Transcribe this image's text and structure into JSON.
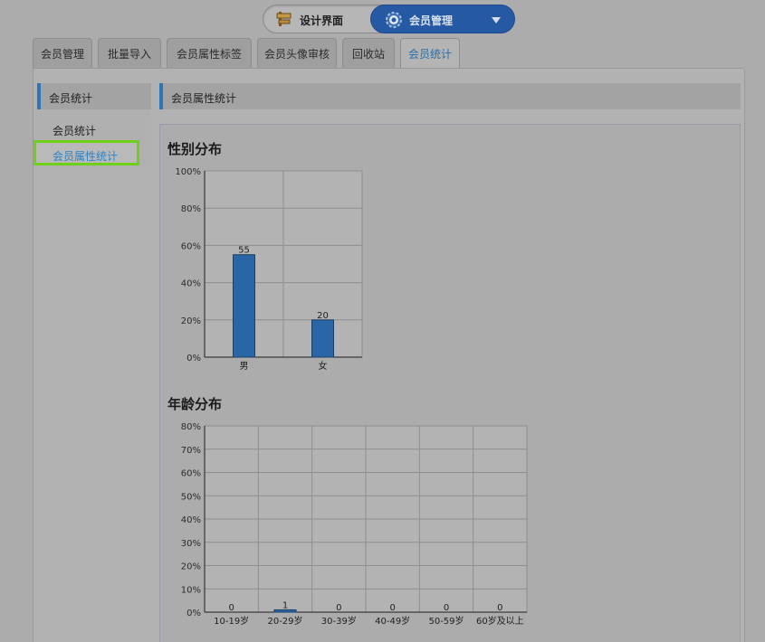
{
  "switcher": {
    "left_label": "设计界面",
    "right_label": "会员管理",
    "left_icon": "signpost-icon",
    "right_icon": "gear-icon",
    "accent": "#2659a3"
  },
  "tabs": [
    {
      "label": "会员管理",
      "active": false
    },
    {
      "label": "批量导入",
      "active": false
    },
    {
      "label": "会员属性标签",
      "active": false
    },
    {
      "label": "会员头像审核",
      "active": false
    },
    {
      "label": "回收站",
      "active": false
    },
    {
      "label": "会员统计",
      "active": true
    }
  ],
  "sidebar": {
    "title": "会员统计",
    "items": [
      {
        "label": "会员统计",
        "selected": false
      },
      {
        "label": "会员属性统计",
        "selected": true
      }
    ]
  },
  "main": {
    "title": "会员属性统计"
  },
  "chart_data": [
    {
      "type": "bar",
      "title": "性别分布",
      "categories": [
        "男",
        "女"
      ],
      "values": [
        55,
        20
      ],
      "data_labels": [
        "55",
        "20"
      ],
      "ylim": [
        0,
        100
      ],
      "yticks": [
        "0%",
        "20%",
        "40%",
        "60%",
        "80%",
        "100%"
      ],
      "xlabel": "",
      "ylabel": "",
      "grid": true,
      "bar_color": "#2a66a6"
    },
    {
      "type": "bar",
      "title": "年龄分布",
      "categories": [
        "10-19岁",
        "20-29岁",
        "30-39岁",
        "40-49岁",
        "50-59岁",
        "60岁及以上"
      ],
      "values": [
        0,
        1,
        0,
        0,
        0,
        0
      ],
      "data_labels": [
        "0",
        "1",
        "0",
        "0",
        "0",
        "0"
      ],
      "ylim": [
        0,
        80
      ],
      "yticks": [
        "0%",
        "10%",
        "20%",
        "30%",
        "40%",
        "50%",
        "60%",
        "70%",
        "80%"
      ],
      "xlabel": "",
      "ylabel": "",
      "grid": true,
      "bar_color": "#2a66a6"
    }
  ]
}
